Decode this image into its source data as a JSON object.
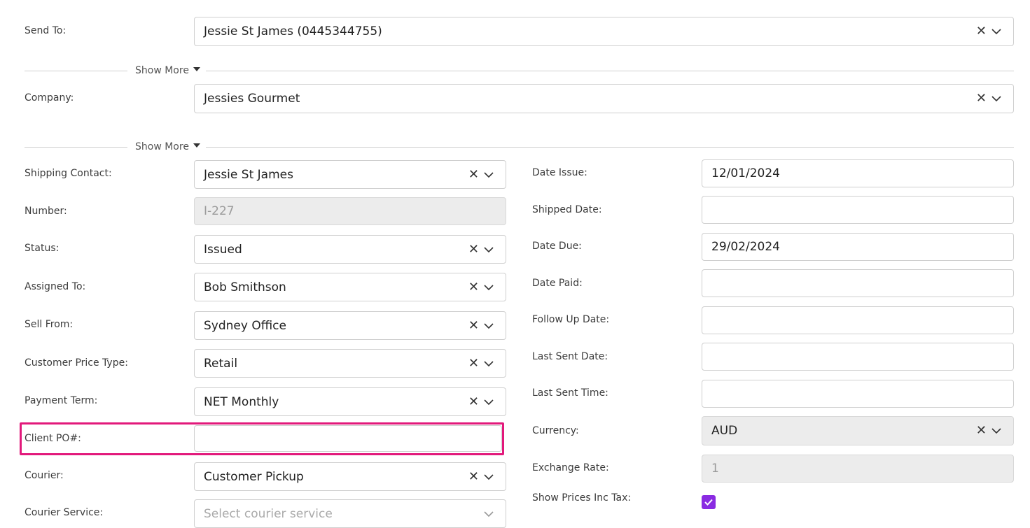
{
  "send_to": {
    "label": "Send To:",
    "value": "Jessie St James (0445344755)"
  },
  "show_more_1": {
    "label": "Show More"
  },
  "company": {
    "label": "Company:",
    "value": "Jessies Gourmet"
  },
  "show_more_2": {
    "label": "Show More"
  },
  "left": {
    "shipping_contact": {
      "label": "Shipping Contact:",
      "value": "Jessie St James"
    },
    "number": {
      "label": "Number:",
      "value": "I-227"
    },
    "status": {
      "label": "Status:",
      "value": "Issued"
    },
    "assigned_to": {
      "label": "Assigned To:",
      "value": "Bob Smithson"
    },
    "sell_from": {
      "label": "Sell From:",
      "value": "Sydney Office"
    },
    "customer_price_type": {
      "label": "Customer Price Type:",
      "value": "Retail"
    },
    "payment_term": {
      "label": "Payment Term:",
      "value": "NET Monthly"
    },
    "client_po": {
      "label": "Client PO#:",
      "value": ""
    },
    "courier": {
      "label": "Courier:",
      "value": "Customer Pickup"
    },
    "courier_service": {
      "label": "Courier Service:",
      "placeholder": "Select courier service"
    }
  },
  "right": {
    "date_issue": {
      "label": "Date Issue:",
      "value": "12/01/2024"
    },
    "shipped_date": {
      "label": "Shipped Date:",
      "value": ""
    },
    "date_due": {
      "label": "Date Due:",
      "value": "29/02/2024"
    },
    "date_paid": {
      "label": "Date Paid:",
      "value": ""
    },
    "follow_up_date": {
      "label": "Follow Up Date:",
      "value": ""
    },
    "last_sent_date": {
      "label": "Last Sent Date:",
      "value": ""
    },
    "last_sent_time": {
      "label": "Last Sent Time:",
      "value": ""
    },
    "currency": {
      "label": "Currency:",
      "value": "AUD"
    },
    "exchange_rate": {
      "label": "Exchange Rate:",
      "value": "1"
    },
    "show_prices_inc_tax": {
      "label": "Show Prices Inc Tax:",
      "checked": true
    }
  },
  "colors": {
    "highlight": "#e2197b",
    "checkbox": "#8a2be2"
  }
}
